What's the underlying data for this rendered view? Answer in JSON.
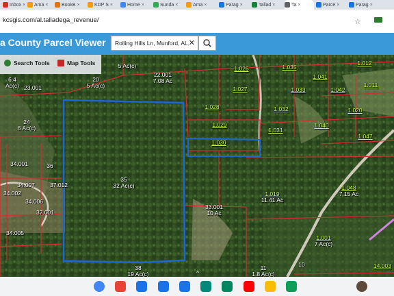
{
  "browser": {
    "tabs": [
      {
        "label": "Inbox",
        "color": "#d93025",
        "active": false
      },
      {
        "label": "Ama",
        "color": "#ff9900",
        "active": false
      },
      {
        "label": "BookB",
        "color": "#e8710a",
        "active": false
      },
      {
        "label": "KDP S",
        "color": "#ff9900",
        "active": false
      },
      {
        "label": "Home",
        "color": "#4285f4",
        "active": false
      },
      {
        "label": "Sunda",
        "color": "#34a853",
        "active": false
      },
      {
        "label": "Ama",
        "color": "#ff9900",
        "active": false
      },
      {
        "label": "Parag",
        "color": "#1a73e8",
        "active": false
      },
      {
        "label": "Tallad",
        "color": "#188038",
        "active": false
      },
      {
        "label": "Ta",
        "color": "#5f6368",
        "active": true
      },
      {
        "label": "Parce",
        "color": "#1a73e8",
        "active": false
      },
      {
        "label": "Parag",
        "color": "#1a73e8",
        "active": false
      }
    ],
    "tab_close": "×",
    "url": "kcsgis.com/al.talladega_revenue/",
    "icons": [
      "star-icon",
      "extension-icon",
      "profile-avatar"
    ]
  },
  "app": {
    "title": "a County Parcel Viewer",
    "search": {
      "value": "Rolling Hills Ln, Munford, AL, 3",
      "clear": "✕"
    },
    "tools": [
      {
        "label": "Search Tools",
        "icon": "search-tools-icon",
        "color": "#2e7d32"
      },
      {
        "label": "Map Tools",
        "icon": "map-tools-icon",
        "color": "#c62828"
      }
    ]
  },
  "parcels": [
    {
      "id": "5 Ac(c)",
      "acres": "",
      "style": "red"
    },
    {
      "id": "22.001",
      "acres": "7.08 Ac",
      "style": "red"
    },
    {
      "id": "1.026",
      "acres": "",
      "style": "green"
    },
    {
      "id": "1.035",
      "acres": "",
      "style": "green"
    },
    {
      "id": "1.012",
      "acres": "",
      "style": "green"
    },
    {
      "id": "1.041",
      "acres": "",
      "style": "green"
    },
    {
      "id": "1.011",
      "acres": "",
      "style": "green"
    },
    {
      "id": "20",
      "acres": "5 Ac(c)",
      "style": "red"
    },
    {
      "id": "1.027",
      "acres": "",
      "style": "green"
    },
    {
      "id": "1.033",
      "acres": "",
      "style": "green"
    },
    {
      "id": "1.042",
      "acres": "",
      "style": "green"
    },
    {
      "id": "6.4",
      "acres": "Ac(c)",
      "style": "red"
    },
    {
      "id": "23.001",
      "acres": "",
      "style": "red"
    },
    {
      "id": "1.028",
      "acres": "",
      "style": "green"
    },
    {
      "id": "1.032",
      "acres": "",
      "style": "green"
    },
    {
      "id": "1.020",
      "acres": "",
      "style": "green"
    },
    {
      "id": "24",
      "acres": "6 Ac(c)",
      "style": "red"
    },
    {
      "id": "1.029",
      "acres": "",
      "style": "green"
    },
    {
      "id": "1.031",
      "acres": "",
      "style": "green"
    },
    {
      "id": "1.040",
      "acres": "",
      "style": "green"
    },
    {
      "id": "1.047",
      "acres": "",
      "style": "green"
    },
    {
      "id": "1.030",
      "acres": "",
      "style": "green"
    },
    {
      "id": "34.001",
      "acres": "",
      "style": "red"
    },
    {
      "id": "36",
      "acres": "",
      "style": "red"
    },
    {
      "id": "35",
      "acres": "32 Ac(c)",
      "style": "red"
    },
    {
      "id": "34.007",
      "acres": "",
      "style": "red"
    },
    {
      "id": "37.012",
      "acres": "",
      "style": "red"
    },
    {
      "id": "1.019",
      "acres": "11.41 Ac",
      "style": "green"
    },
    {
      "id": "1.048",
      "acres": "7.15 Ac",
      "style": "green"
    },
    {
      "id": "34.002",
      "acres": "",
      "style": "red"
    },
    {
      "id": "34.006",
      "acres": "",
      "style": "red"
    },
    {
      "id": "33.001",
      "acres": "10 Ac",
      "style": "red"
    },
    {
      "id": "37.001",
      "acres": "",
      "style": "red"
    },
    {
      "id": "34.005",
      "acres": "",
      "style": "red"
    },
    {
      "id": "1.001",
      "acres": "7 Ac(c)",
      "style": "green"
    },
    {
      "id": "38",
      "acres": "19 Ac(c)",
      "style": "red"
    },
    {
      "id": "11",
      "acres": "1.8 Ac(c)",
      "style": "red"
    },
    {
      "id": "10",
      "acres": "",
      "style": "red"
    },
    {
      "id": "14.003",
      "acres": "",
      "style": "green"
    }
  ],
  "shelf": {
    "apps": [
      {
        "name": "chrome-icon",
        "color": "#4285f4"
      },
      {
        "name": "gmail-icon",
        "color": "#ea4335"
      },
      {
        "name": "calendar-icon",
        "color": "#1a73e8"
      },
      {
        "name": "files-icon",
        "color": "#1a73e8"
      },
      {
        "name": "messages-icon",
        "color": "#1a73e8"
      },
      {
        "name": "meet-icon",
        "color": "#00897b"
      },
      {
        "name": "play-store-icon",
        "color": "#01875f"
      },
      {
        "name": "youtube-icon",
        "color": "#ff0000"
      },
      {
        "name": "photos-icon",
        "color": "#fbbc04"
      },
      {
        "name": "sheets-icon",
        "color": "#0f9d58"
      },
      {
        "name": "user-avatar",
        "color": "#5d4a3a"
      }
    ]
  },
  "colors": {
    "header": "#3a9ad9",
    "parcel_line": "#d32f2f",
    "selected_parcel": "#1e66d0",
    "label_green": "#c8ff4a"
  }
}
